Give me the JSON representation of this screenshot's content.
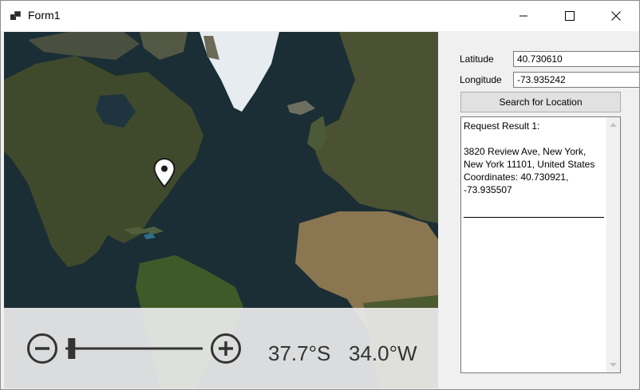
{
  "window": {
    "title": "Form1",
    "controls": {
      "minimize": "minimize",
      "maximize": "maximize",
      "close": "close"
    }
  },
  "map": {
    "zoom_out_icon": "minus-circle-icon",
    "zoom_in_icon": "plus-circle-icon",
    "pin_icon": "map-pin-icon",
    "zoom_level": 0.02,
    "center_latitude": "37.7°S",
    "center_longitude": "34.0°W"
  },
  "form": {
    "latitude_label": "Latitude",
    "latitude_value": "40.730610",
    "longitude_label": "Longitude",
    "longitude_value": "-73.935242",
    "search_button": "Search for Location",
    "result_text": "Request Result 1:\n\n3820 Review Ave, New York, New York 11101, United States\nCoordinates: 40.730921, -73.935507"
  },
  "colors": {
    "window_bg": "#f0f0f0",
    "ocean": "#1b2e35",
    "land": "#3f4a2c",
    "ice": "#e6ecef",
    "overlay": "#ececec"
  }
}
